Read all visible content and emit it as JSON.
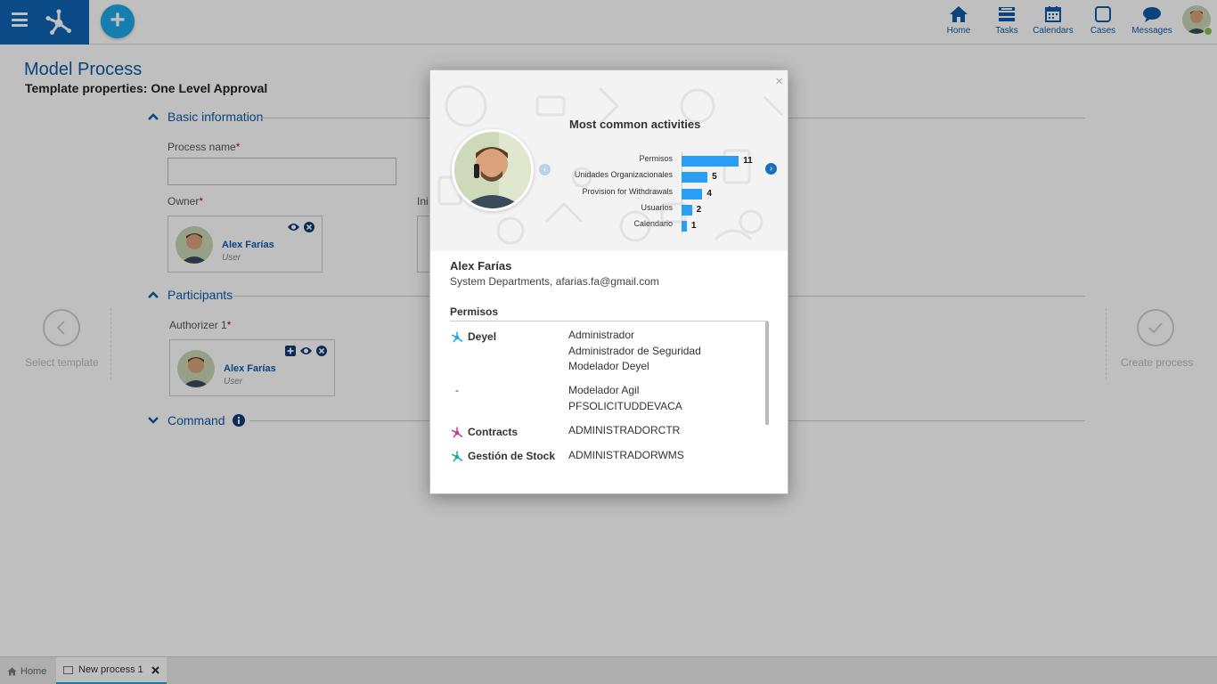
{
  "topnav": {
    "items": [
      {
        "label": "Home",
        "icon": "home-icon"
      },
      {
        "label": "Tasks",
        "icon": "tasks-icon"
      },
      {
        "label": "Calendars",
        "icon": "calendar-icon"
      },
      {
        "label": "Cases",
        "icon": "cases-icon"
      },
      {
        "label": "Messages",
        "icon": "messages-icon"
      }
    ]
  },
  "page": {
    "title": "Model Process",
    "subtitle": "Template properties: One Level Approval",
    "sections": {
      "basic": "Basic information",
      "participants": "Participants",
      "command": "Command"
    },
    "fields": {
      "process_name": "Process name",
      "owner": "Owner",
      "initiator_partial": "Ini",
      "authorizer": "Authorizer 1"
    },
    "owner_card": {
      "name": "Alex Farías",
      "role": "User"
    },
    "authorizer_card": {
      "name": "Alex Farías",
      "role": "User"
    },
    "steps": {
      "select_template": "Select template",
      "create_process": "Create process"
    }
  },
  "footer": {
    "tabs": [
      {
        "label": "Home"
      },
      {
        "label": "New process 1"
      }
    ]
  },
  "modal": {
    "close": "×",
    "chart_title": "Most common activities",
    "person": {
      "name": "Alex Farías",
      "info": "System Departments, afarias.fa@gmail.com"
    },
    "permissions_title": "Permisos",
    "apps": [
      {
        "name": "Deyel",
        "color": "#1ba9e8",
        "roles": [
          "Administrador",
          "Administrador de Seguridad",
          "Modelador Deyel"
        ]
      },
      {
        "name": "-",
        "roles": [
          "Modelador Agil",
          "PFSOLICITUDDEVACA"
        ]
      },
      {
        "name": "Contracts",
        "color": "#c2389c",
        "roles": [
          "ADMINISTRADORCTR"
        ]
      },
      {
        "name": "Gestión de Stock",
        "color": "#1ba9a0",
        "roles": [
          "ADMINISTRADORWMS"
        ]
      }
    ]
  },
  "chart_data": {
    "type": "bar",
    "orientation": "horizontal",
    "title": "Most common activities",
    "categories": [
      "Permisos",
      "Unidades Organizacionales",
      "Provision for Withdrawals",
      "Usuarios",
      "Calendario"
    ],
    "values": [
      11,
      5,
      4,
      2,
      1
    ],
    "xlim": [
      0,
      12
    ],
    "color": "#2a9df4"
  }
}
